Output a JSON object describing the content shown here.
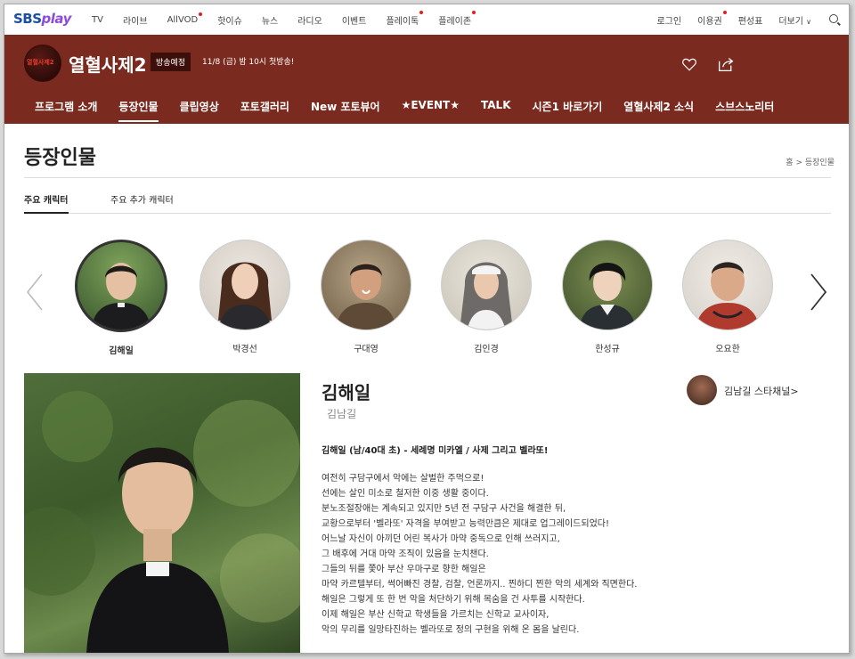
{
  "topnav": {
    "logo_sbs": "SBS",
    "logo_play": "play",
    "links": [
      {
        "label": "TV",
        "dot": false
      },
      {
        "label": "라이브",
        "dot": false
      },
      {
        "label": "AllVOD",
        "dot": true
      },
      {
        "label": "핫이슈",
        "dot": false
      },
      {
        "label": "뉴스",
        "dot": false
      },
      {
        "label": "라디오",
        "dot": false
      },
      {
        "label": "이벤트",
        "dot": false
      },
      {
        "label": "플레이톡",
        "dot": true
      },
      {
        "label": "플레이존",
        "dot": true
      }
    ],
    "login": "로그인",
    "subscription": "이용권",
    "schedule": "편성표",
    "more": "더보기"
  },
  "program": {
    "logo_text": "열혈사제2",
    "title": "열혈사제2",
    "status_badge": "방송예정",
    "premiere": "11/8 (금) 밤 10시 첫방송!"
  },
  "menu": [
    "프로그램 소개",
    "등장인물",
    "클립영상",
    "포토갤러리",
    "New 포토뷰어",
    "★EVENT★",
    "TALK",
    "시즌1 바로가기",
    "열혈사제2 소식",
    "스브스노리터"
  ],
  "page": {
    "title": "등장인물",
    "breadcrumb_home": "홈",
    "breadcrumb_sep": ">",
    "breadcrumb_current": "등장인물"
  },
  "subtabs": [
    "주요 캐릭터",
    "주요 추가 캐릭터"
  ],
  "characters": [
    "김해일",
    "박경선",
    "구대영",
    "김인경",
    "한성규",
    "오요한"
  ],
  "detail": {
    "name": "김해일",
    "actor": "김남길",
    "star_channel": "김남길 스타채널>",
    "summary": "김해일 (남/40대 초)  - 세례명 미카엘 / 사제 그리고 벨라또!",
    "lines": [
      "여전히 구담구에서 악에는 살벌한 주먹으로!",
      "선에는 살인 미소로 철저한 이중 생활 중이다.",
      "분노조절장애는 계속되고 있지만 5년 전 구담구 사건을 해결한 뒤,",
      "교황으로부터 '벨라또' 자격을 부여받고 능력만큼은 제대로 업그레이드되었다!",
      "어느날 자신이 아끼던 어린 복사가 마약 중독으로 인해 쓰러지고,",
      "그 배후에 거대 마약 조직이 있음을 눈치챈다.",
      "그들의 뒤를 쫓아 부산 우마구로 향한 해일은",
      "마약 카르텔부터, 썩어빠진 경찰, 검찰, 언론까지.. 찐하디 찐한 악의 세계와 직면한다.",
      "해일은 그렇게 또 한 번 악을 처단하기 위해 목숨을 건 사투를 시작한다.",
      "이제 해일은 부산 신학교 학생들을 가르치는 신학교 교사이자,",
      "악의 무리를 일망타진하는 벨라또로 정의 구현을 위해 온 몸을 날린다."
    ]
  },
  "colors": {
    "band": "#7a2a1f",
    "badge": "#3d0f0a",
    "notification_dot": "#e02020",
    "logo_sbs": "#1b4fa0",
    "logo_play": "#8d4bd9"
  }
}
